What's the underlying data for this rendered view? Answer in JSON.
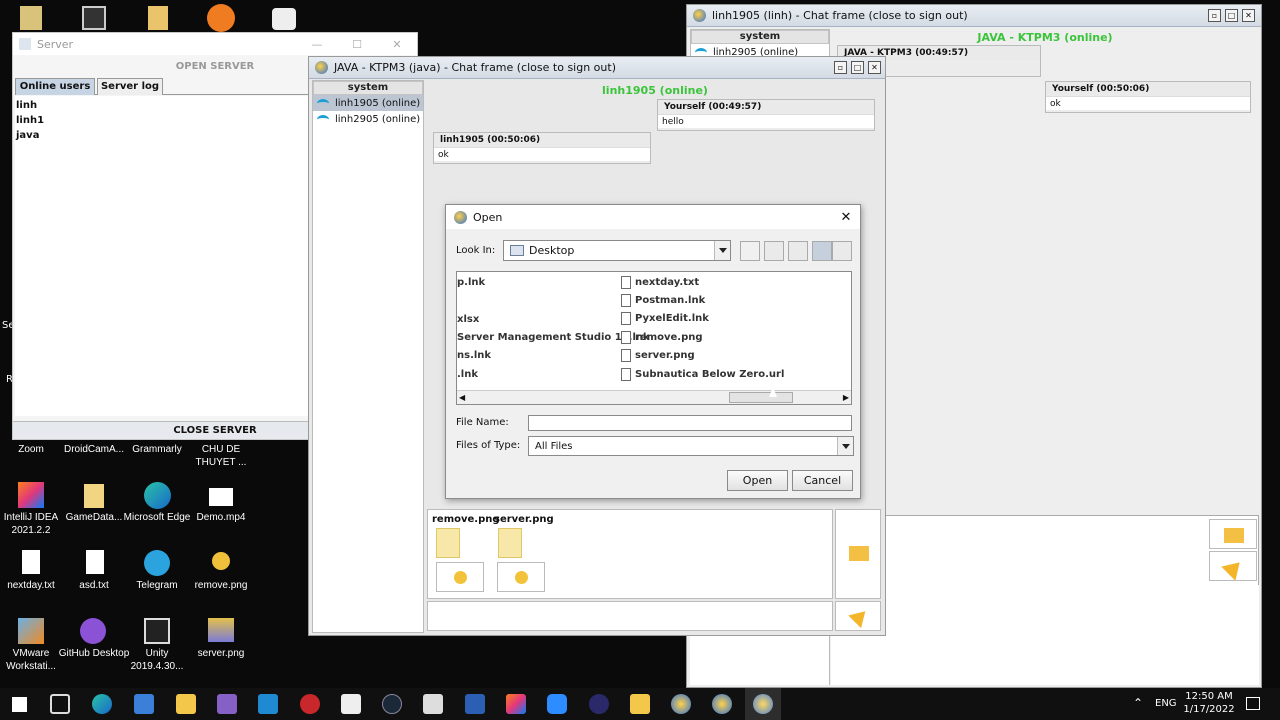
{
  "desktop": {
    "icons": [
      {
        "label": "Zoom"
      },
      {
        "label": "DroidCamA..."
      },
      {
        "label": "Grammarly"
      },
      {
        "label": "CHU DE THUYET ..."
      },
      {
        "label": "IntelliJ IDEA 2021.2.2"
      },
      {
        "label": "GameData..."
      },
      {
        "label": "Microsoft Edge"
      },
      {
        "label": "Demo.mp4"
      },
      {
        "label": "nextday.txt"
      },
      {
        "label": "asd.txt"
      },
      {
        "label": "Telegram"
      },
      {
        "label": "remove.png"
      },
      {
        "label": "VMware Workstati..."
      },
      {
        "label": "GitHub Desktop"
      },
      {
        "label": "Unity 2019.4.30..."
      },
      {
        "label": "server.png"
      }
    ],
    "edge_chars": [
      "Se",
      "R"
    ]
  },
  "server_window": {
    "title": "Server",
    "open_button": "OPEN SERVER",
    "close_button": "CLOSE SERVER",
    "tabs": [
      "Online users",
      "Server log"
    ],
    "users": [
      "linh",
      "linh1",
      "java"
    ]
  },
  "chat_linh": {
    "title": "linh1905 (linh) - Chat frame (close to sign out)",
    "header": "JAVA - KTPM3 (online)",
    "sidebar_head": "system",
    "sidebar_item": "linh2905 (online)",
    "msg_other_header": "JAVA - KTPM3 (00:49:57)",
    "msg_self_header": "Yourself (00:50:06)",
    "msg_self_text": "ok"
  },
  "chat_java": {
    "title": "JAVA - KTPM3 (java) - Chat frame (close to sign out)",
    "header": "linh1905 (online)",
    "sidebar_head": "system",
    "users": [
      "linh1905 (online)",
      "linh2905 (online)"
    ],
    "messages": [
      {
        "header": "Yourself (00:49:57)",
        "text": "hello"
      },
      {
        "header": "linh1905 (00:50:06)",
        "text": "ok"
      }
    ],
    "attachments": [
      "remove.png",
      "server.png"
    ]
  },
  "open_dialog": {
    "title": "Open",
    "look_in_label": "Look In:",
    "look_in_value": "Desktop",
    "left_col": [
      "p.lnk",
      "xlsx",
      "Server Management Studio 18.lnk",
      "ns.lnk",
      ".lnk"
    ],
    "right_col": [
      "nextday.txt",
      "Postman.lnk",
      "PyxelEdit.lnk",
      "remove.png",
      "server.png",
      "Subnautica Below Zero.url"
    ],
    "file_name_label": "File Name:",
    "file_name_value": "",
    "file_type_label": "Files of Type:",
    "file_type_value": "All Files",
    "open_button": "Open",
    "cancel_button": "Cancel"
  },
  "taskbar": {
    "lang": "ENG",
    "time": "12:50 AM",
    "date": "1/17/2022"
  }
}
